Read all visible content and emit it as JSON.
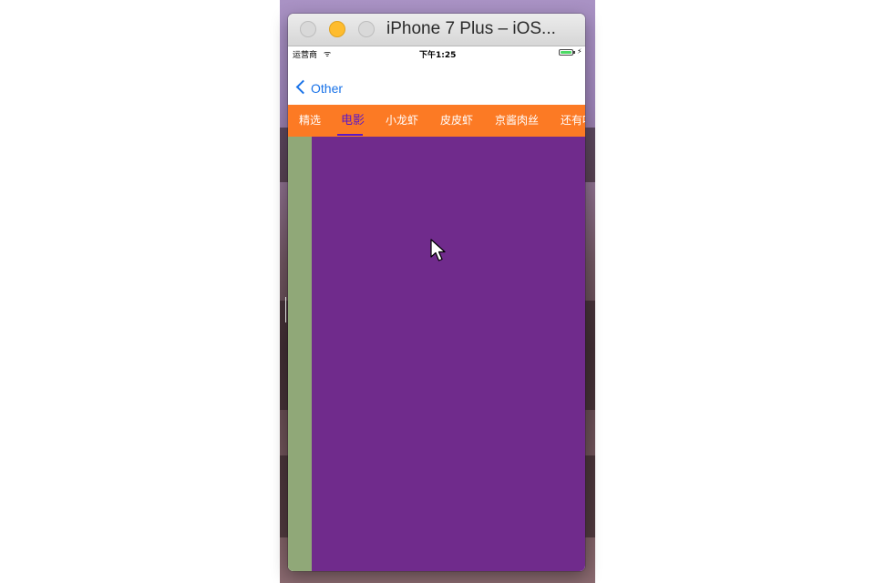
{
  "window": {
    "title": "iPhone 7 Plus – iOS..."
  },
  "status_bar": {
    "carrier": "运营商",
    "time": "下午1:25",
    "wifi_icon": "wifi-icon",
    "battery_icon": "battery-icon"
  },
  "nav_bar": {
    "back_label": "Other",
    "back_icon": "chevron-left-icon"
  },
  "tabs": [
    {
      "label": "精选",
      "active": false
    },
    {
      "label": "电影",
      "active": true
    },
    {
      "label": "小龙虾",
      "active": false
    },
    {
      "label": "皮皮虾",
      "active": false
    },
    {
      "label": "京酱肉丝",
      "active": false
    },
    {
      "label": "还有喵",
      "active": false
    }
  ],
  "colors": {
    "tab_bar": "#fc7a24",
    "tab_text": "#ffffff",
    "tab_active": "#5a18c8",
    "side_panel": "#90a878",
    "main_panel": "#702b8c",
    "back_link": "#1a73e8"
  }
}
